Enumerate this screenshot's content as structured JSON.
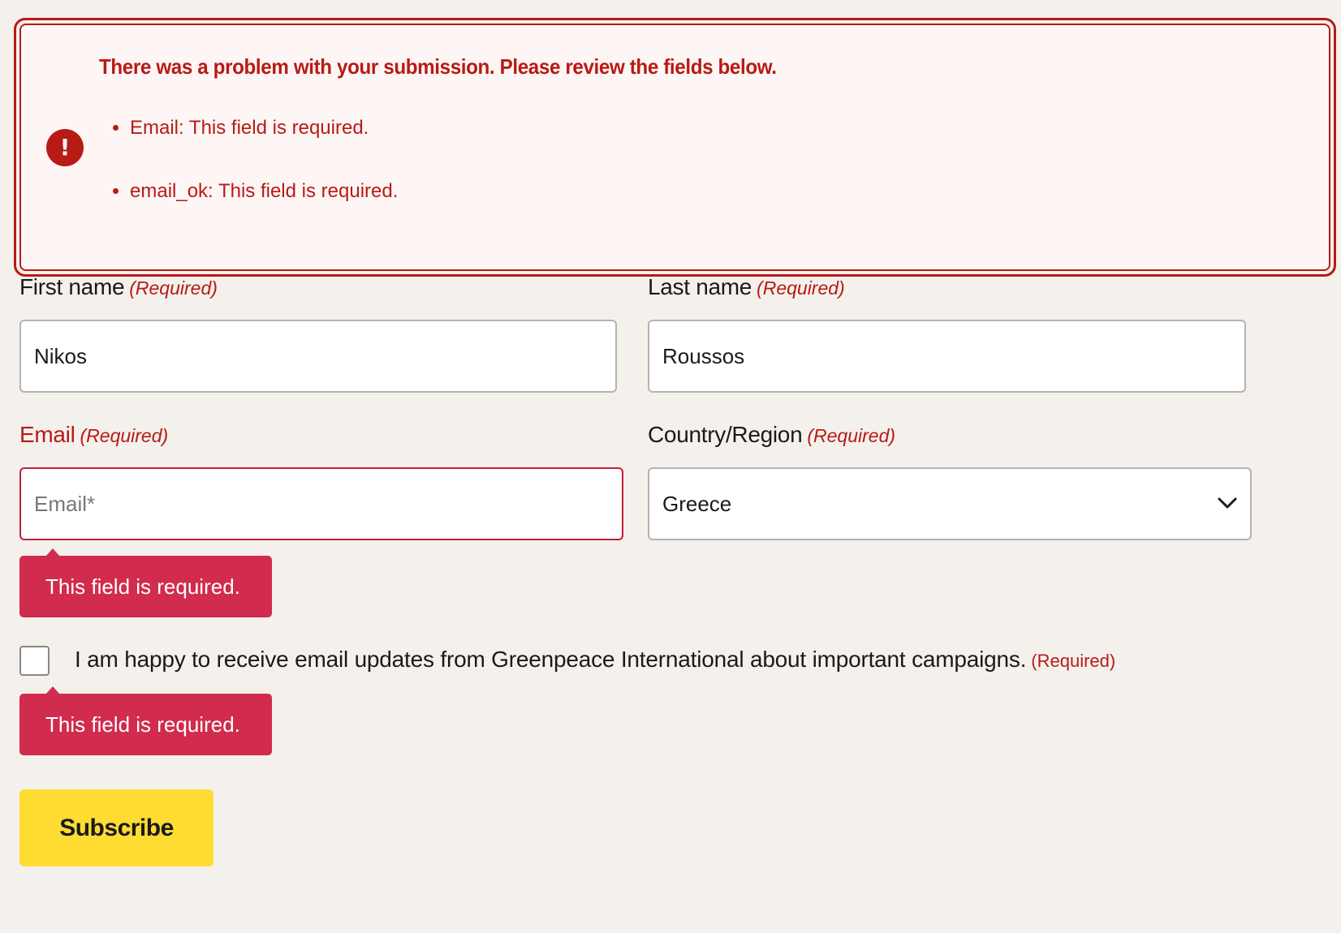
{
  "error_summary": {
    "title": "There was a problem with your submission. Please review the fields below.",
    "icon": "alert-circle-icon",
    "icon_glyph": "!",
    "items": [
      "Email: This field is required.",
      "email_ok: This field is required."
    ]
  },
  "form": {
    "required_marker": "(Required)",
    "first_name": {
      "label": "First name",
      "value": "Nikos"
    },
    "last_name": {
      "label": "Last name",
      "value": "Roussos"
    },
    "email": {
      "label": "Email",
      "value": "",
      "placeholder": "Email*",
      "error": "This field is required."
    },
    "country": {
      "label": "Country/Region",
      "selected": "Greece"
    },
    "consent": {
      "label": "I am happy to receive email updates from Greenpeace International about important campaigns.",
      "checked": false,
      "error": "This field is required."
    },
    "submit_label": "Subscribe"
  },
  "colors": {
    "error": "#b81a16",
    "tooltip": "#d12b4d",
    "button": "#ffdc32",
    "background": "#f4f1ec"
  }
}
